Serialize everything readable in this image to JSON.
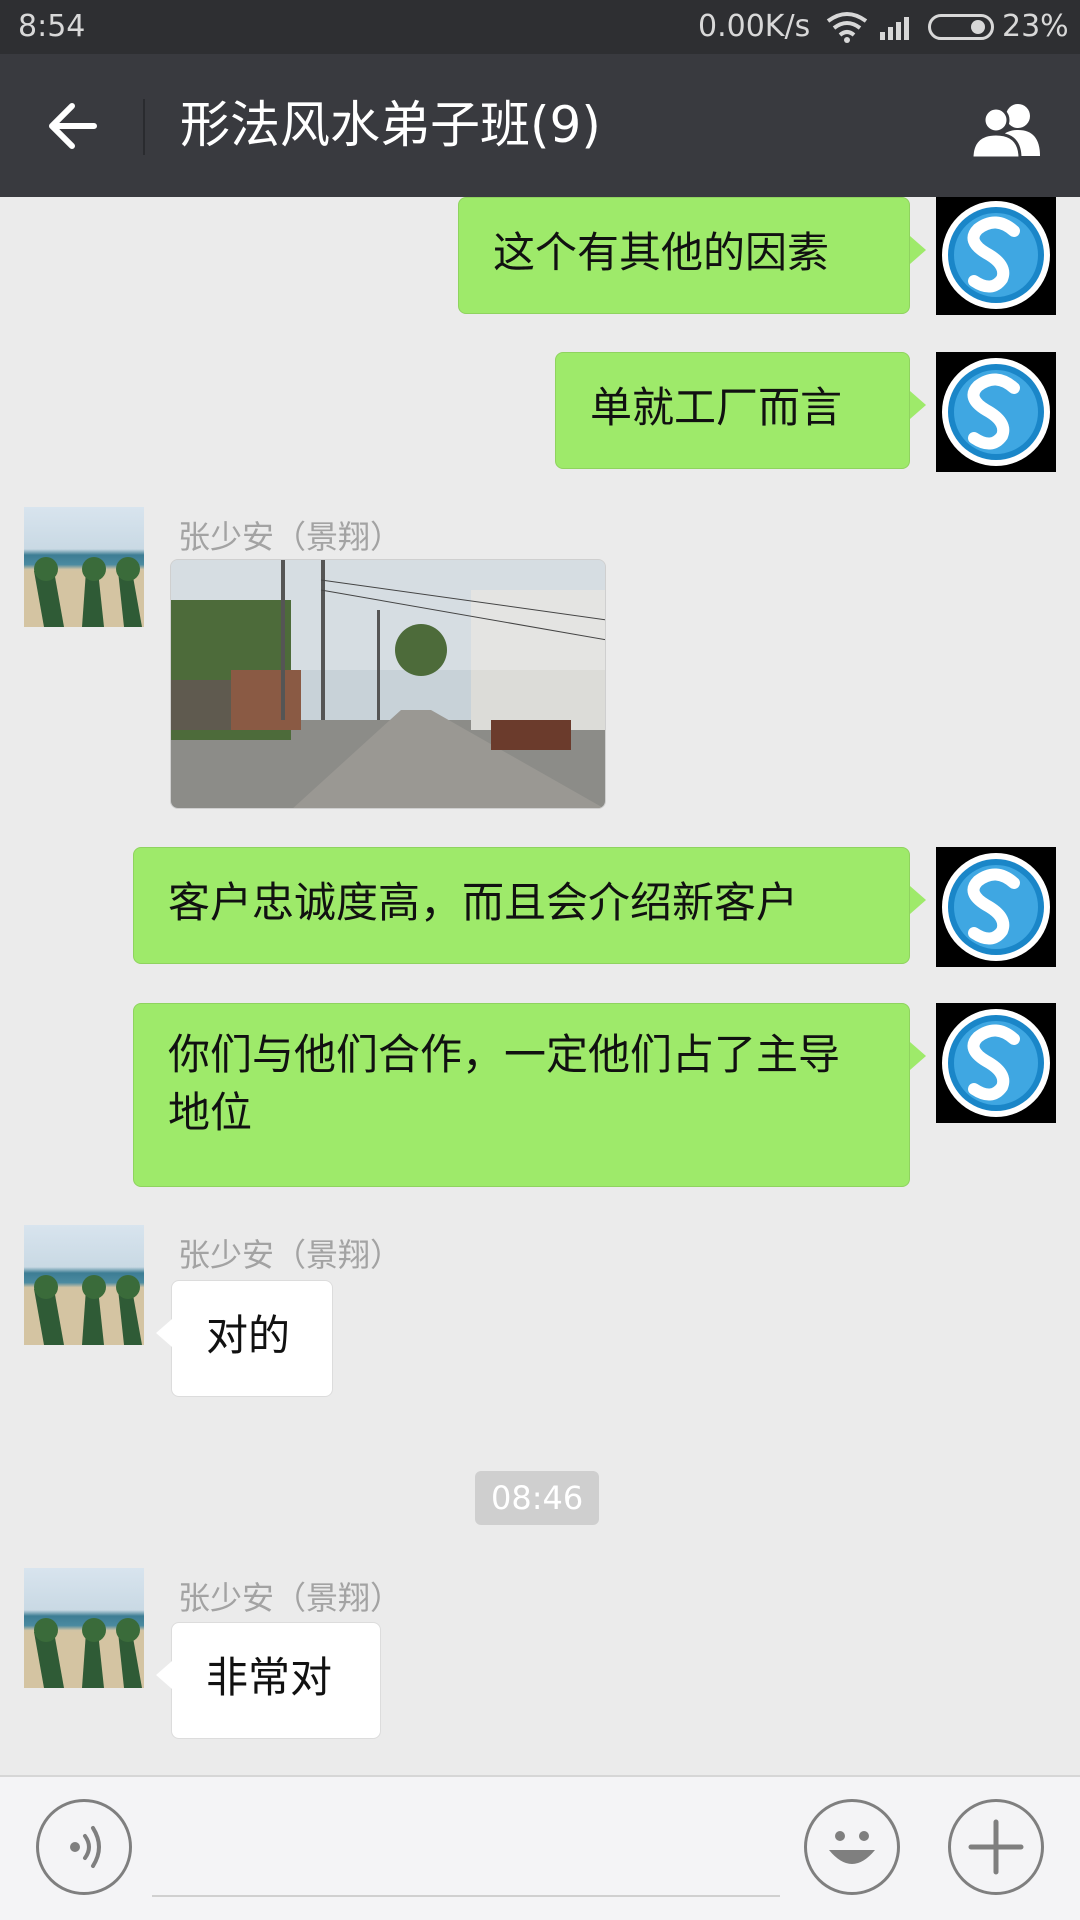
{
  "status_bar": {
    "time": "8:54",
    "net_speed": "0.00K/s",
    "battery_percent": "23%",
    "battery_level": 0.23
  },
  "header": {
    "title": "形法风水弟子班(9)"
  },
  "messages": {
    "m1": {
      "text": "这个有其他的因素"
    },
    "m2": {
      "text": "单就工厂而言"
    },
    "m3": {
      "sender": "张少安（景翔）"
    },
    "m4": {
      "text": "客户忠诚度高，而且会介绍新客户"
    },
    "m5": {
      "text": "你们与他们合作，一定他们占了主导地位"
    },
    "m6": {
      "sender": "张少安（景翔）",
      "text": "对的"
    },
    "m7": {
      "sender": "张少安（景翔）",
      "text": "非常对"
    }
  },
  "timestamp": "08:46",
  "colors": {
    "outgoing_bubble": "#9eea6a",
    "incoming_bubble": "#ffffff",
    "title_bar": "#393a3f",
    "status_bar": "#2e2f32",
    "chat_background": "#ebebeb"
  },
  "icons": {
    "back": "arrow-left-icon",
    "members": "people-icon",
    "voice": "voice-icon",
    "emoji": "smiley-icon",
    "more": "plus-icon"
  }
}
